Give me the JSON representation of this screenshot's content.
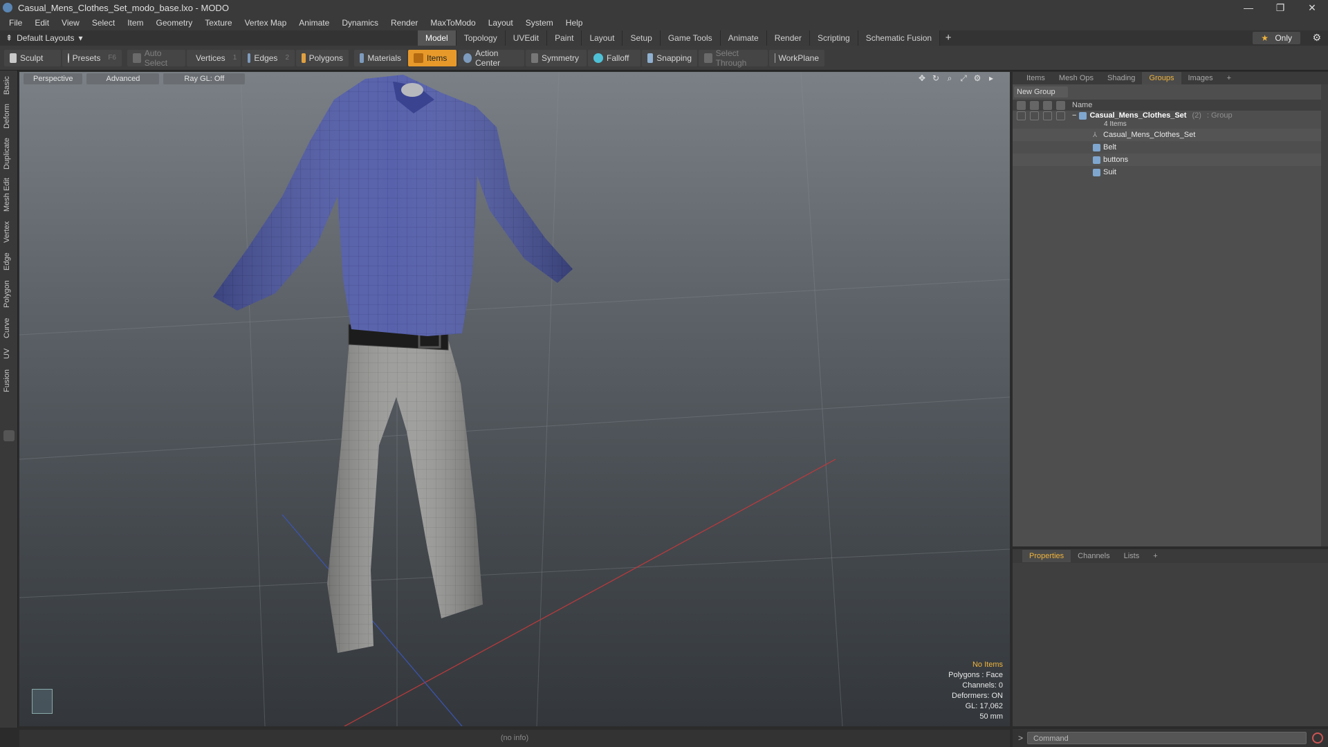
{
  "window": {
    "title": "Casual_Mens_Clothes_Set_modo_base.lxo - MODO",
    "controls": [
      "—",
      "❐",
      "✕"
    ]
  },
  "menu": [
    "File",
    "Edit",
    "View",
    "Select",
    "Item",
    "Geometry",
    "Texture",
    "Vertex Map",
    "Animate",
    "Dynamics",
    "Render",
    "MaxToModo",
    "Layout",
    "System",
    "Help"
  ],
  "layoutbar": {
    "layout_label": "Default Layouts",
    "tabs": [
      "Model",
      "Topology",
      "UVEdit",
      "Paint",
      "Layout",
      "Setup",
      "Game Tools",
      "Animate",
      "Render",
      "Scripting",
      "Schematic Fusion"
    ],
    "active_tab": "Model",
    "plus": "+",
    "only_label": "Only"
  },
  "toolbar": {
    "sculpt": "Sculpt",
    "presets": "Presets",
    "presets_key": "F6",
    "auto_select": "Auto Select",
    "vertices": "Vertices",
    "vertices_key": "1",
    "edges": "Edges",
    "edges_key": "2",
    "polygons": "Polygons",
    "materials": "Materials",
    "items": "Items",
    "action_center": "Action Center",
    "symmetry": "Symmetry",
    "falloff": "Falloff",
    "snapping": "Snapping",
    "select_through": "Select Through",
    "workplane": "WorkPlane"
  },
  "left_tabs": [
    "Basic",
    "Deform",
    "Duplicate",
    "Mesh Edit",
    "Vertex",
    "Edge",
    "Polygon",
    "Curve",
    "UV",
    "Fusion"
  ],
  "viewport": {
    "buttons": [
      "Perspective",
      "Advanced",
      "Ray GL: Off"
    ],
    "info": {
      "selection": "No Items",
      "polygons": "Polygons : Face",
      "channels": "Channels: 0",
      "deformers": "Deformers: ON",
      "gl": "GL: 17,062",
      "lens": "50 mm"
    },
    "colors": {
      "shirt": "#4f5aa8",
      "pants": "#9a9a98",
      "belt": "#1c1c1c"
    }
  },
  "status": {
    "text": "(no info)"
  },
  "groups_panel": {
    "tabs": [
      "Items",
      "Mesh Ops",
      "Shading",
      "Groups",
      "Images",
      "+"
    ],
    "active_tab": "Groups",
    "new_group": "New Group",
    "column_name": "Name",
    "group": {
      "name": "Casual_Mens_Clothes_Set",
      "count": "(2)",
      "type": ": Group",
      "sub": "4 Items"
    },
    "items": [
      "Casual_Mens_Clothes_Set",
      "Belt",
      "buttons",
      "Suit"
    ]
  },
  "properties_panel": {
    "tabs": [
      "Properties",
      "Channels",
      "Lists",
      "+"
    ],
    "active_tab": "Properties"
  },
  "command": {
    "prompt": ">",
    "placeholder": "Command"
  }
}
